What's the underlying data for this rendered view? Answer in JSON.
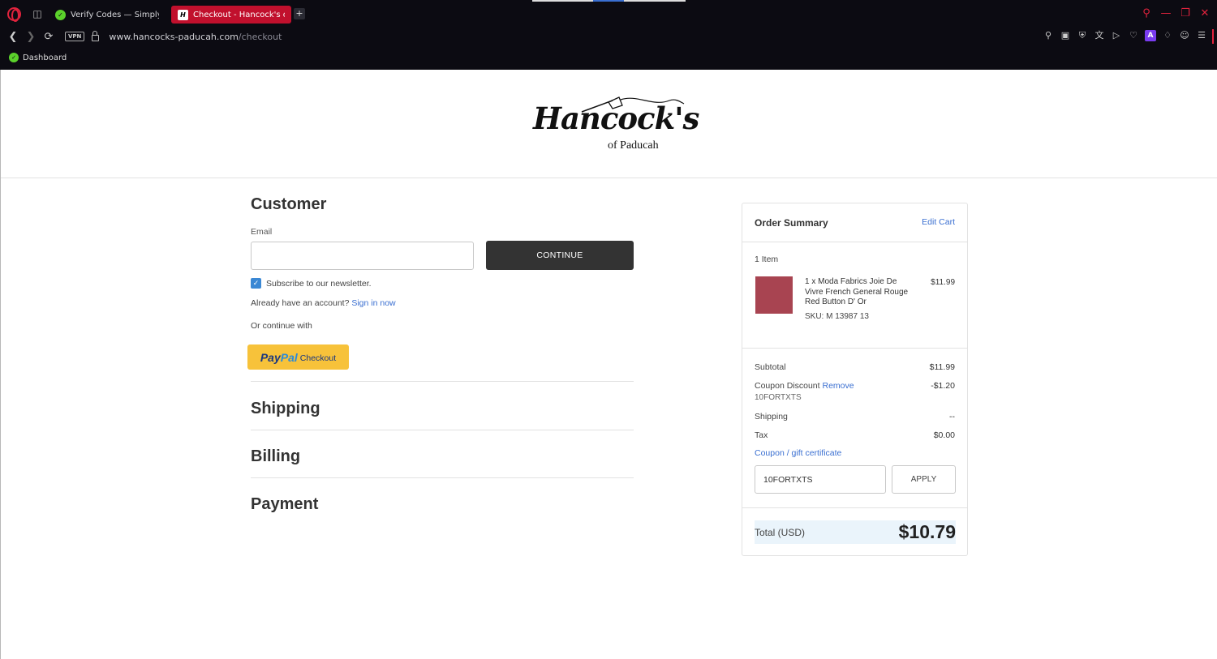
{
  "browser": {
    "tabs": [
      {
        "label": "Verify Codes — SimplyCo",
        "active": false
      },
      {
        "label": "Checkout - Hancock's of",
        "active": true
      }
    ],
    "url_host": "www.hancocks-paducah.com",
    "url_path": "/checkout",
    "vpn_label": "VPN",
    "bookmarks": [
      {
        "label": "Dashboard"
      }
    ],
    "accent_color": "#e0233d"
  },
  "site": {
    "logo_main": "Hancock's",
    "logo_sub": "of Paducah"
  },
  "customer": {
    "heading": "Customer",
    "email_label": "Email",
    "email_value": "",
    "continue_label": "CONTINUE",
    "newsletter_label": "Subscribe to our newsletter.",
    "newsletter_checked": true,
    "account_prompt": "Already have an account?",
    "sign_in_label": "Sign in now",
    "or_continue": "Or continue with",
    "paypal_pay": "Pay",
    "paypal_pal": "Pal",
    "paypal_checkout": "Checkout"
  },
  "sections": {
    "shipping": "Shipping",
    "billing": "Billing",
    "payment": "Payment"
  },
  "summary": {
    "title": "Order Summary",
    "edit_cart": "Edit Cart",
    "item_count": "1 Item",
    "item": {
      "name": "1 x Moda Fabrics Joie De Vivre French General Rouge Red Button D' Or",
      "sku_label": "SKU:",
      "sku": "M 13987 13",
      "price": "$11.99",
      "swatch_color": "#a84451"
    },
    "subtotal_label": "Subtotal",
    "subtotal": "$11.99",
    "coupon_label": "Coupon Discount",
    "coupon_remove": "Remove",
    "coupon_discount": "-$1.20",
    "coupon_code": "10FORTXTS",
    "shipping_label": "Shipping",
    "shipping": "--",
    "tax_label": "Tax",
    "tax": "$0.00",
    "coupon_link": "Coupon / gift certificate",
    "coupon_input_value": "10FORTXTS",
    "apply_label": "APPLY",
    "total_label": "Total (USD)",
    "total": "$10.79"
  }
}
